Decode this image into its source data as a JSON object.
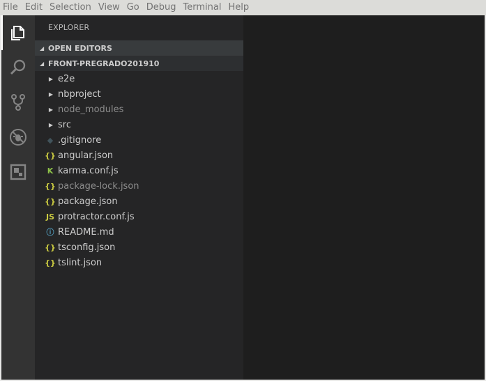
{
  "menubar": {
    "items": [
      "File",
      "Edit",
      "Selection",
      "View",
      "Go",
      "Debug",
      "Terminal",
      "Help"
    ]
  },
  "activitybar": {
    "icons": [
      "files-icon",
      "search-icon",
      "source-control-icon",
      "debug-icon",
      "extensions-icon"
    ]
  },
  "sidebar": {
    "title": "EXPLORER",
    "open_editors": "OPEN EDITORS",
    "project": "FRONT-PREGRADO201910",
    "items": [
      {
        "label": "e2e",
        "kind": "folder",
        "glyph": "▶"
      },
      {
        "label": "nbproject",
        "kind": "folder",
        "glyph": "▶"
      },
      {
        "label": "node_modules",
        "kind": "folder",
        "glyph": "▶",
        "dim": true
      },
      {
        "label": "src",
        "kind": "folder",
        "glyph": "▶"
      },
      {
        "label": ".gitignore",
        "kind": "file",
        "glyph": "◆",
        "color": "#41535b"
      },
      {
        "label": "angular.json",
        "kind": "file",
        "glyph": "{}",
        "color": "#cbcb41"
      },
      {
        "label": "karma.conf.js",
        "kind": "file",
        "glyph": "K",
        "color": "#8dc149"
      },
      {
        "label": "package-lock.json",
        "kind": "file",
        "glyph": "{}",
        "color": "#cbcb41",
        "dim": true
      },
      {
        "label": "package.json",
        "kind": "file",
        "glyph": "{}",
        "color": "#cbcb41"
      },
      {
        "label": "protractor.conf.js",
        "kind": "file",
        "glyph": "JS",
        "color": "#cbcb41"
      },
      {
        "label": "README.md",
        "kind": "file",
        "glyph": "ⓘ",
        "color": "#519aba"
      },
      {
        "label": "tsconfig.json",
        "kind": "file",
        "glyph": "{}",
        "color": "#cbcb41"
      },
      {
        "label": "tslint.json",
        "kind": "file",
        "glyph": "{}",
        "color": "#cbcb41"
      }
    ]
  },
  "colors": {
    "activitybar": "#333333",
    "sidebar": "#252526",
    "editor": "#1e1e1e"
  }
}
